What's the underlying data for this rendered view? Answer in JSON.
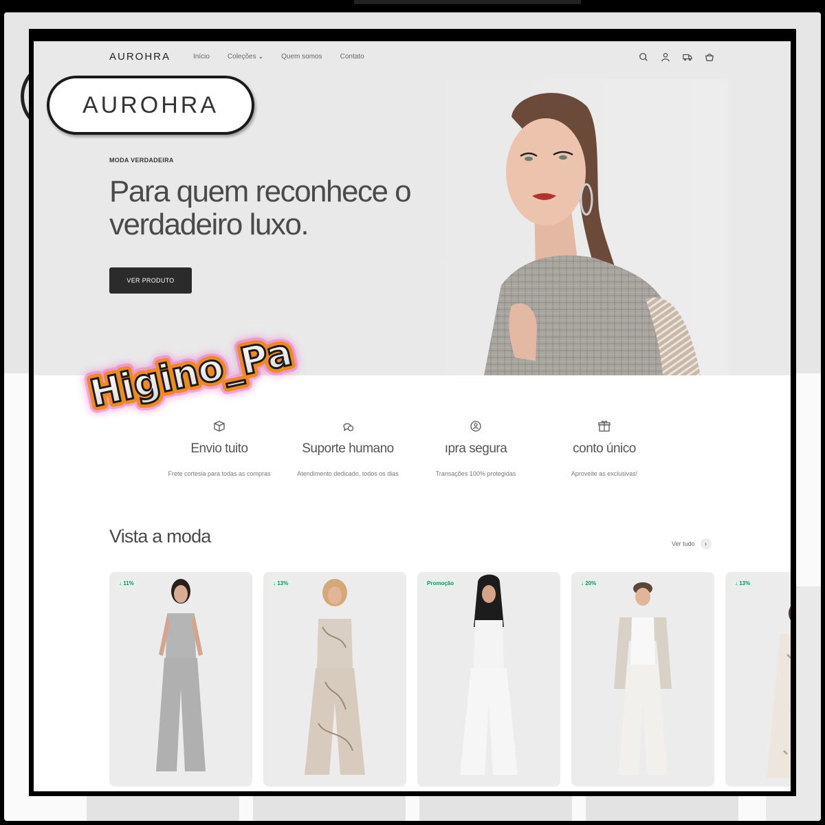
{
  "brand": {
    "name": "AUROHRA",
    "badge_text": "AUROHRA"
  },
  "nav": {
    "items": [
      {
        "label": "Início"
      },
      {
        "label": "Coleções",
        "has_dropdown": true
      },
      {
        "label": "Quem somos"
      },
      {
        "label": "Contato"
      }
    ],
    "icons": [
      "search-icon",
      "account-icon",
      "truck-icon",
      "cart-icon"
    ]
  },
  "hero": {
    "kicker": "MODA VERDADEIRA",
    "title_line1": "Para quem reconhece o",
    "title_line2": "verdadeiro luxo.",
    "button_label": "VER PRODUTO"
  },
  "watermark": {
    "text": "Higino_Pa"
  },
  "features": [
    {
      "icon": "box-icon",
      "title": "Envio     tuito",
      "description": "Frete cortesia para todas as compras"
    },
    {
      "icon": "chat-icon",
      "title": "Suporte humano",
      "description": "Atendimento dedicado, todos os dias"
    },
    {
      "icon": "shield-icon",
      "title": "ıpra segura",
      "description": "Transações 100% protegidas"
    },
    {
      "icon": "gift-icon",
      "title": "conto único",
      "description": "Aproveite      as exclusivas!"
    }
  ],
  "products_section": {
    "title": "Vista a moda",
    "see_all_label": "Ver tudo",
    "products": [
      {
        "badge": "↓ 11%",
        "outfit_color": "#b5b5b5"
      },
      {
        "badge": "↓ 13%",
        "outfit_color": "#d9cfc2"
      },
      {
        "badge": "Promoção",
        "outfit_color": "#f4f4f4"
      },
      {
        "badge": "↓ 20%",
        "outfit_color": "#f1f0ec"
      },
      {
        "badge": "↓ 13%",
        "outfit_color": "#ece6dc"
      }
    ]
  },
  "colors": {
    "accent_dark": "#2b2b2b",
    "badge_green": "#1e8a62",
    "hero_bg": "#e9e9e9"
  }
}
